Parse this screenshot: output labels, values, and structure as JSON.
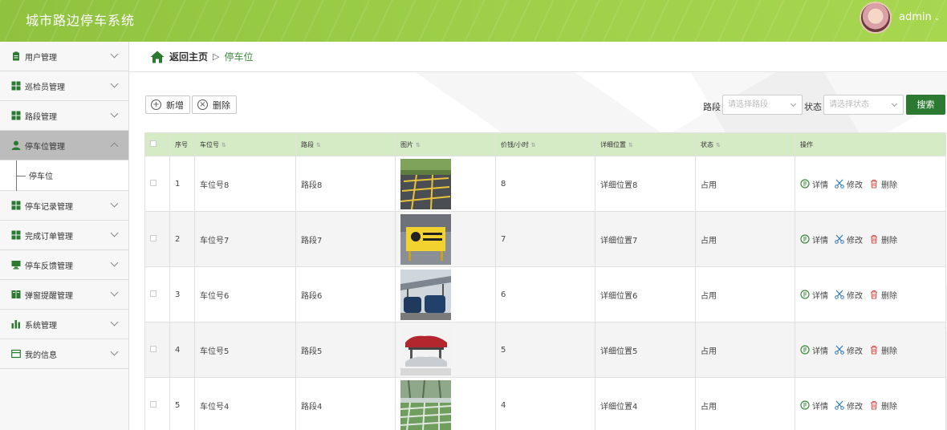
{
  "header": {
    "title": "城市路边停车系统",
    "username": "admin"
  },
  "sidebar": {
    "items": [
      {
        "label": "用户管理"
      },
      {
        "label": "巡检员管理"
      },
      {
        "label": "路段管理"
      },
      {
        "label": "停车位管理",
        "active": true
      },
      {
        "label": "停车记录管理"
      },
      {
        "label": "完成订单管理"
      },
      {
        "label": "停车反馈管理"
      },
      {
        "label": "弹窗提醒管理"
      },
      {
        "label": "系统管理"
      },
      {
        "label": "我的信息"
      }
    ],
    "submenu_label": "停车位"
  },
  "breadcrumb": {
    "home": "返回主页",
    "separator": "▷",
    "current": "停车位"
  },
  "toolbar": {
    "add_label": "新增",
    "delete_label": "删除"
  },
  "filters": {
    "road_label": "路段",
    "road_placeholder": "请选择路段",
    "status_label": "状态",
    "status_placeholder": "请选择状态",
    "search_label": "搜索"
  },
  "table": {
    "headers": [
      "序号",
      "车位号",
      "路段",
      "图片",
      "价钱/小时",
      "详细位置",
      "状态",
      "操作"
    ],
    "actions": {
      "detail": "详情",
      "edit": "修改",
      "delete": "删除"
    },
    "rows": [
      {
        "no": "1",
        "space": "车位号8",
        "road": "路段8",
        "image": "lot-lines",
        "price": "8",
        "location": "详细位置8",
        "status": "占用"
      },
      {
        "no": "2",
        "space": "车位号7",
        "road": "路段7",
        "image": "yellow-sign",
        "price": "7",
        "location": "详细位置7",
        "status": "占用"
      },
      {
        "no": "3",
        "space": "车位号6",
        "road": "路段6",
        "image": "carport",
        "price": "6",
        "location": "详细位置6",
        "status": "占用"
      },
      {
        "no": "4",
        "space": "车位号5",
        "road": "路段5",
        "image": "car-lift",
        "price": "5",
        "location": "详细位置5",
        "status": "占用"
      },
      {
        "no": "5",
        "space": "车位号4",
        "road": "路段4",
        "image": "grass-pavers",
        "price": "4",
        "location": "详细位置4",
        "status": "占用"
      }
    ]
  },
  "colors": {
    "header": "#9ed04a",
    "accent": "#2c7a32",
    "table_header": "#d4ebc6",
    "delete": "#d9534f",
    "link": "#3c8a3c"
  }
}
